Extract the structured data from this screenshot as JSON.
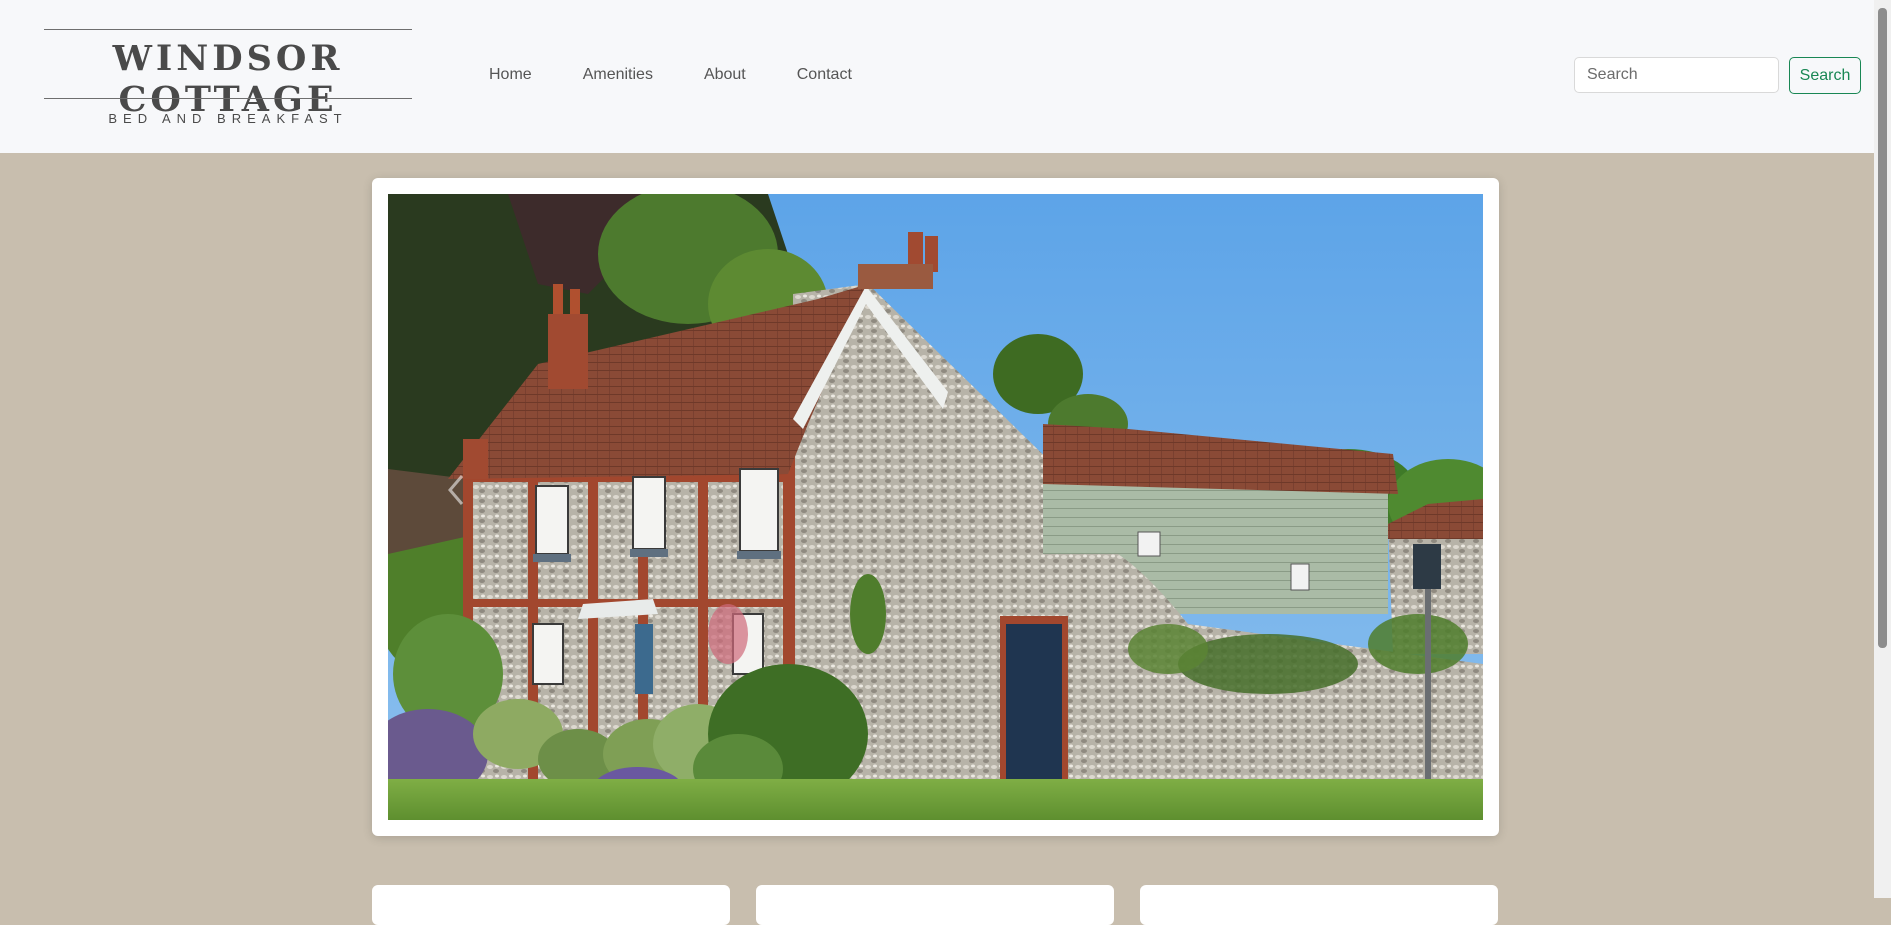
{
  "brand": {
    "title": "WINDSOR COTTAGE",
    "subtitle": "BED AND BREAKFAST"
  },
  "nav": {
    "items": [
      {
        "label": "Home"
      },
      {
        "label": "Amenities"
      },
      {
        "label": "About"
      },
      {
        "label": "Contact"
      }
    ]
  },
  "search": {
    "placeholder": "Search",
    "value": "",
    "button_label": "Search"
  },
  "carousel": {
    "image_alt": "Flint and brick cottage with garden"
  },
  "colors": {
    "accent": "#198754",
    "page_background": "#c8beae",
    "navbar_background": "#f7f8fa"
  },
  "icons": [
    "chevron-left-icon"
  ]
}
